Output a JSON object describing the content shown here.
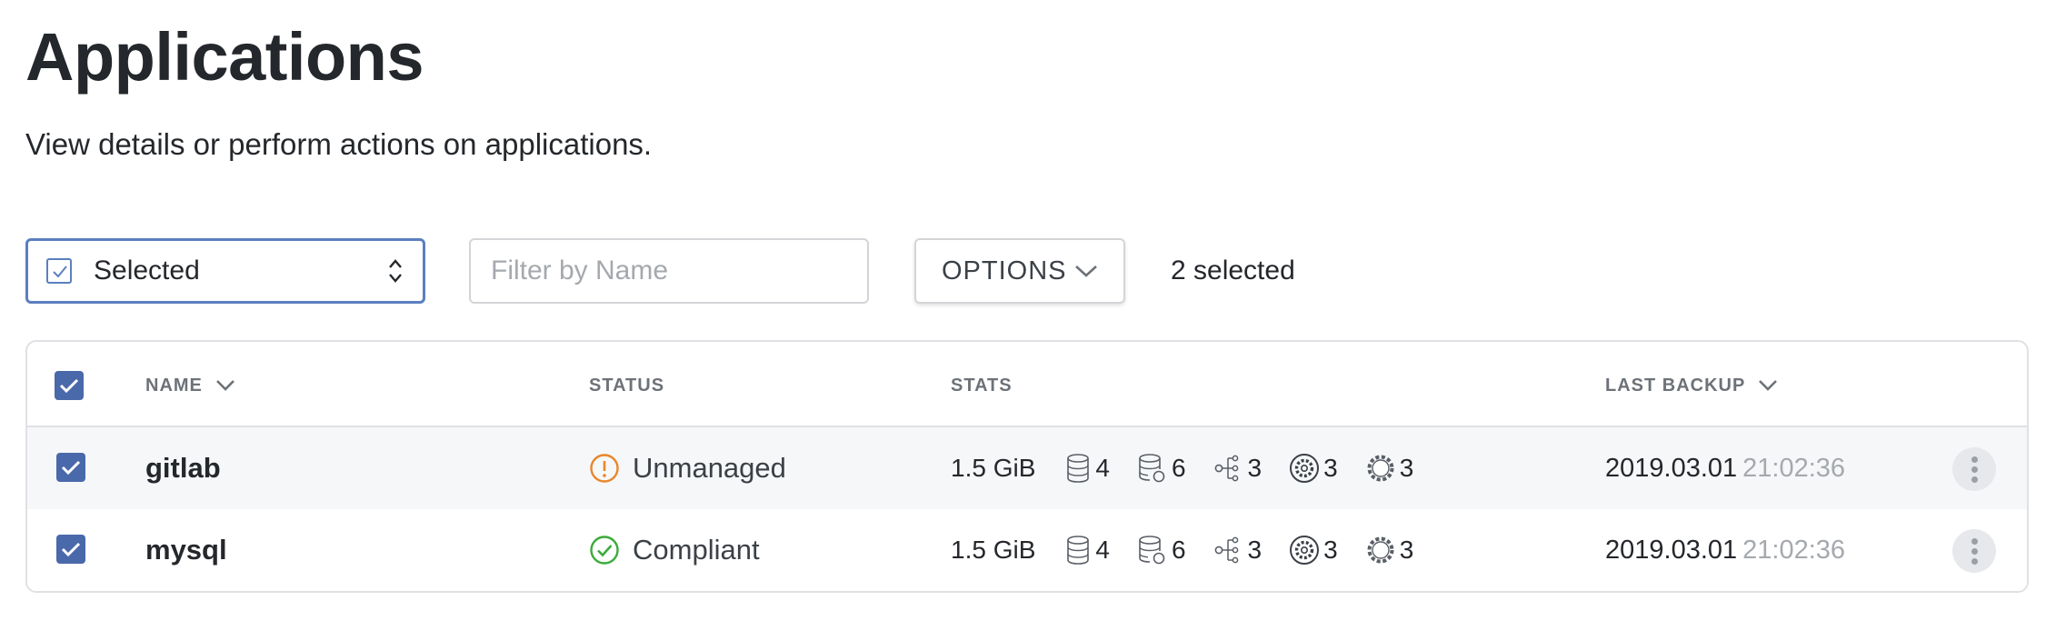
{
  "page": {
    "title": "Applications",
    "subtitle": "View details or perform actions on applications."
  },
  "toolbar": {
    "select_label": "Selected",
    "filter_placeholder": "Filter by Name",
    "options_label": "OPTIONS",
    "selected_count": "2 selected"
  },
  "table": {
    "columns": {
      "name": "NAME",
      "status": "STATUS",
      "stats": "STATS",
      "last_backup": "LAST BACKUP"
    },
    "rows": [
      {
        "name": "gitlab",
        "status": "Unmanaged",
        "status_icon": "warning-circle-icon",
        "size": "1.5 GiB",
        "volumes": "4",
        "snapshots": "6",
        "services": "3",
        "hooks": "3",
        "settings": "3",
        "backup_date": "2019.03.01",
        "backup_time": "21:02:36"
      },
      {
        "name": "mysql",
        "status": "Compliant",
        "status_icon": "check-circle-icon",
        "size": "1.5 GiB",
        "volumes": "4",
        "snapshots": "6",
        "services": "3",
        "hooks": "3",
        "settings": "3",
        "backup_date": "2019.03.01",
        "backup_time": "21:02:36"
      }
    ]
  },
  "colors": {
    "accent": "#4a69aa",
    "warning": "#e8872a",
    "success": "#3bab3b"
  }
}
